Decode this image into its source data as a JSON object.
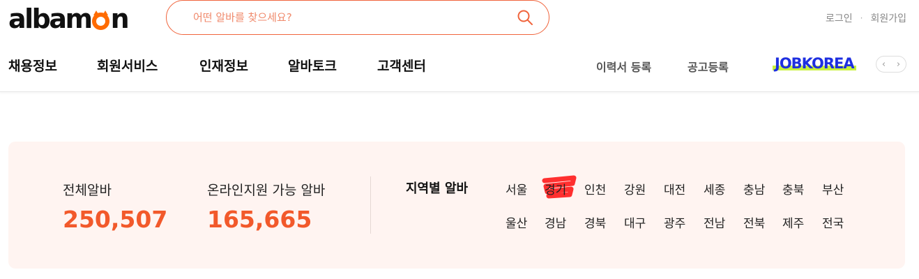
{
  "logo": {
    "before": "alba",
    "after": "n",
    "middle": "m"
  },
  "search": {
    "placeholder": "어떤 알바를 찾으세요?"
  },
  "util": {
    "login": "로그인",
    "separator": "·",
    "signup": "회원가입"
  },
  "nav": {
    "items": [
      "채용정보",
      "회원서비스",
      "인재정보",
      "알바토크",
      "고객센터"
    ],
    "resume": "이력서 등록",
    "post": "공고등록",
    "partner": "JOBKOREA",
    "prev": "‹",
    "next": "›"
  },
  "stats": {
    "total_label": "전체알바",
    "total_value": "250,507",
    "online_label": "온라인지원 가능 알바",
    "online_value": "165,665"
  },
  "regions": {
    "title": "지역별 알바",
    "row1": [
      "서울",
      "경기",
      "인천",
      "강원",
      "대전",
      "세종",
      "충남",
      "충북",
      "부산"
    ],
    "row2": [
      "울산",
      "경남",
      "경북",
      "대구",
      "광주",
      "전남",
      "전북",
      "제주",
      "전국"
    ]
  },
  "colors": {
    "brand": "#ff6b00",
    "accent": "#f2592b",
    "panel_bg": "#fff4f1",
    "jobkorea": "#1e2fe0",
    "highlight": "#ff0000"
  }
}
